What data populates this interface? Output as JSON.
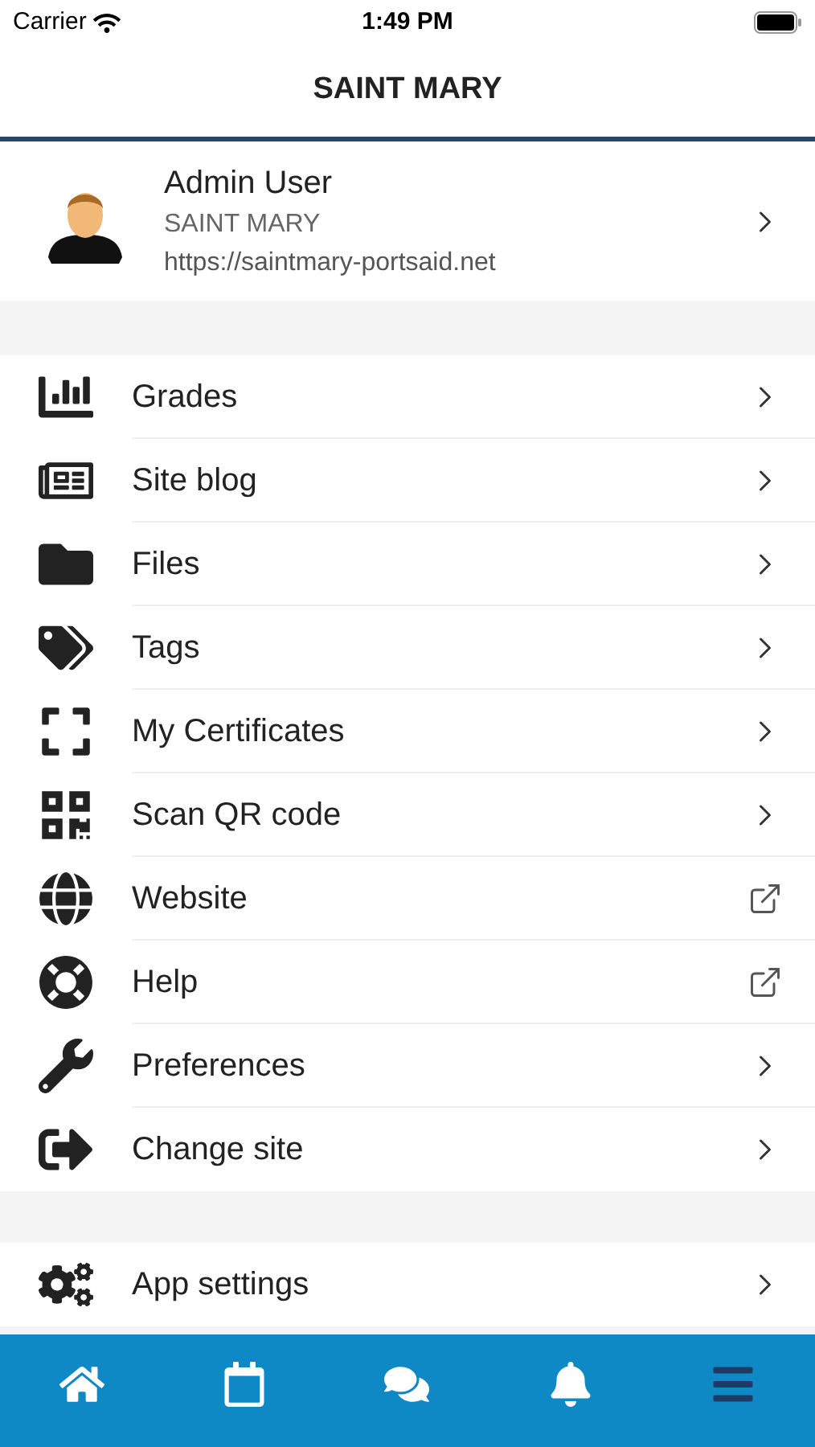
{
  "status_bar": {
    "carrier": "Carrier",
    "time": "1:49 PM"
  },
  "header": {
    "title": "SAINT MARY"
  },
  "profile": {
    "name": "Admin User",
    "site": "SAINT MARY",
    "url": "https://saintmary-portsaid.net"
  },
  "menu": [
    {
      "label": "Grades",
      "kind": "chevron"
    },
    {
      "label": "Site blog",
      "kind": "chevron"
    },
    {
      "label": "Files",
      "kind": "chevron"
    },
    {
      "label": "Tags",
      "kind": "chevron"
    },
    {
      "label": "My Certificates",
      "kind": "chevron"
    },
    {
      "label": "Scan QR code",
      "kind": "chevron"
    },
    {
      "label": "Website",
      "kind": "external"
    },
    {
      "label": "Help",
      "kind": "external"
    },
    {
      "label": "Preferences",
      "kind": "chevron"
    },
    {
      "label": "Change site",
      "kind": "chevron"
    }
  ],
  "menu_2": [
    {
      "label": "App settings",
      "kind": "chevron"
    }
  ],
  "tab_bar": [
    {
      "selected": false
    },
    {
      "selected": false
    },
    {
      "selected": false
    },
    {
      "selected": false
    },
    {
      "selected": true
    }
  ]
}
